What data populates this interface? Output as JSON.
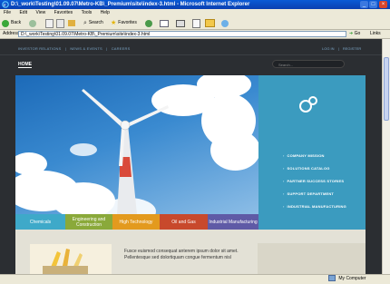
{
  "window": {
    "title": "D:\\_work\\Testing\\01.09.07\\Metro-KB\\_Premium\\site\\index-3.html - Microsoft Internet Explorer"
  },
  "menubar": [
    "File",
    "Edit",
    "View",
    "Favorites",
    "Tools",
    "Help"
  ],
  "toolbar": {
    "back": "Back",
    "search": "Search",
    "favorites": "Favorites"
  },
  "address": {
    "label": "Address",
    "value": "D:\\_work\\Testing\\01.09.07\\Metro-KB\\_Premium\\site\\index-3.html",
    "go": "Go",
    "links": "Links"
  },
  "site": {
    "toplinks": [
      "INVESTOR RELATIONS",
      "|",
      "NEWS & EVENTS",
      "|",
      "CAREERS"
    ],
    "login": "LOG IN",
    "register": "REGISTER",
    "nav_home": "HOME",
    "search_placeholder": "Search...",
    "side_menu": [
      "COMPANY MISSION",
      "SOLUTIONS CATALOG",
      "PARTNER SUCCESS STORIES",
      "SUPPORT DEPARTMENT",
      "INDUSTRIAL MANUFACTURING"
    ],
    "tabs": [
      {
        "label": "Chemicals",
        "color": "#3ea9c9"
      },
      {
        "label": "Engineering and Construction",
        "color": "#8aa93a"
      },
      {
        "label": "High Technology",
        "color": "#e39a1e"
      },
      {
        "label": "Oil and Gas",
        "color": "#c8492c"
      },
      {
        "label": "Industrial Manufacturing",
        "color": "#5f5aa6"
      }
    ],
    "body_line1": "Fusce euismod consequat anterem ipsum dolor sit amet.",
    "body_line2": "Pellentesque sed dolortiquam congue fermentum nisl"
  },
  "status": {
    "text": "",
    "zone": "My Computer"
  }
}
